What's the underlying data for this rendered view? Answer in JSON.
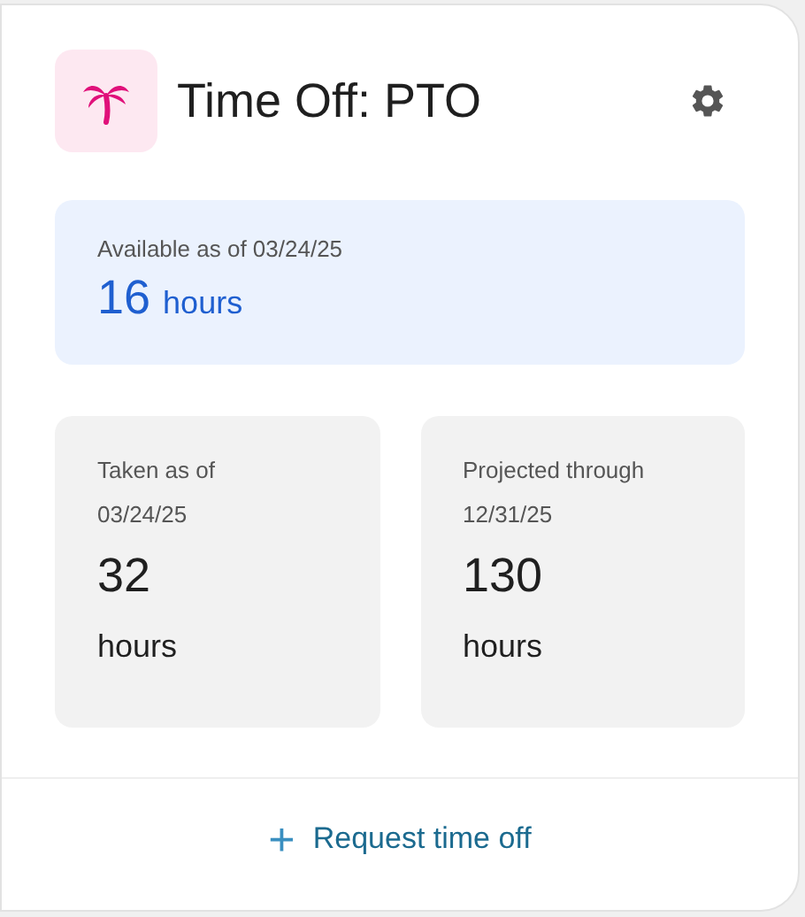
{
  "header": {
    "title": "Time Off: PTO"
  },
  "available": {
    "label": "Available as of 03/24/25",
    "value": "16",
    "unit": "hours"
  },
  "stats": [
    {
      "label": "Taken as of 03/24/25",
      "value": "32",
      "unit": "hours"
    },
    {
      "label": "Projected through 12/31/25",
      "value": "130",
      "unit": "hours"
    }
  ],
  "action": {
    "icon": "+",
    "label": "Request time off"
  }
}
